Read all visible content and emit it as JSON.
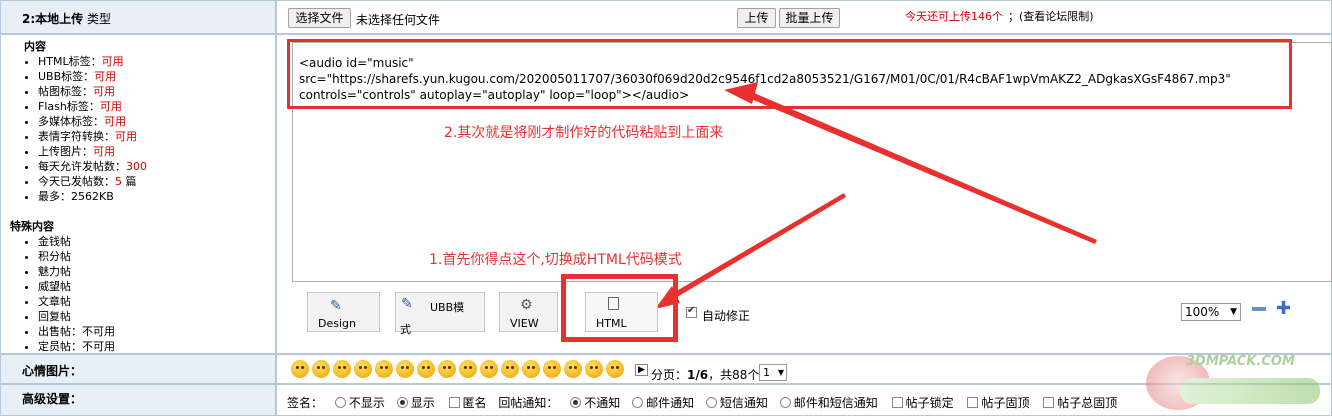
{
  "upload_row": {
    "label": "2:本地上传",
    "label_suffix": "类型",
    "choose_file_button": "选择文件",
    "no_file_text": "未选择任何文件",
    "upload_button": "上传",
    "batch_upload_button": "批量上传",
    "quota_text": "今天还可上传146个",
    "forum_limit_link": "；(查看论坛限制)"
  },
  "sidebar": {
    "content_title": "内容",
    "content_items": [
      {
        "label": "HTML标签：",
        "value": "可用"
      },
      {
        "label": "UBB标签：",
        "value": "可用"
      },
      {
        "label": "帖图标签：",
        "value": "可用"
      },
      {
        "label": "Flash标签：",
        "value": "可用"
      },
      {
        "label": "多媒体标签：",
        "value": "可用"
      },
      {
        "label": "表情字符转换：",
        "value": "可用"
      },
      {
        "label": "上传图片：",
        "value": "可用"
      },
      {
        "label": "每天允许发帖数：",
        "value": "300"
      },
      {
        "label": "今天已发帖数：",
        "value": "5",
        "suffix": " 篇"
      },
      {
        "label": "最多：",
        "value": "2562KB"
      }
    ],
    "special_title": "特殊内容",
    "special_items": [
      "金钱帖",
      "积分帖",
      "魅力帖",
      "威望帖",
      "文章帖",
      "回复帖",
      "出售帖：不可用",
      "定员帖：不可用"
    ]
  },
  "editor": {
    "code_line1": "<audio id=\"music\"",
    "code_line2": "src=\"https://sharefs.yun.kugou.com/202005011707/36030f069d20d2c9546f1cd2a8053521/G167/M01/0C/01/R4cBAF1wpVmAKZ2_ADgkasXGsF4867.mp3\"",
    "code_line3": "controls=\"controls\" autoplay=\"autoplay\" loop=\"loop\"></audio>",
    "annotation_step2": "2.其次就是将刚才制作好的代码粘贴到上面来",
    "annotation_step1": "1.首先你得点这个,切换成HTML代码模式"
  },
  "toolbar": {
    "design_label": "Design",
    "ubb_label": "UBB模式",
    "view_label": "VIEW",
    "html_label": "HTML",
    "auto_fix_label": "自动修正",
    "auto_fix_checked": true,
    "zoom_value": "100%"
  },
  "mood_row": {
    "label": "心情图片：",
    "page_prefix": "分页：",
    "page_info": "1/6",
    "total_text": "，共88个",
    "page_select": "1"
  },
  "advanced_row": {
    "label": "高级设置：",
    "signature_label": "签名：",
    "sig_hide": "不显示",
    "sig_show": "显示",
    "anonymous": "匿名",
    "reply_notify_label": "回帖通知：",
    "no_notify": "不通知",
    "email_notify": "邮件通知",
    "sms_notify": "短信通知",
    "email_sms_notify": "邮件和短信通知",
    "lock_post": "帖子锁定",
    "pin_post": "帖子固顶",
    "global_pin": "帖子总固顶"
  },
  "watermark": {
    "text": "3DMPACK.COM"
  },
  "colors": {
    "annotation_red": "#e8312f",
    "row_label_bg": "#e9eff7",
    "accent_red": "#d40000"
  }
}
